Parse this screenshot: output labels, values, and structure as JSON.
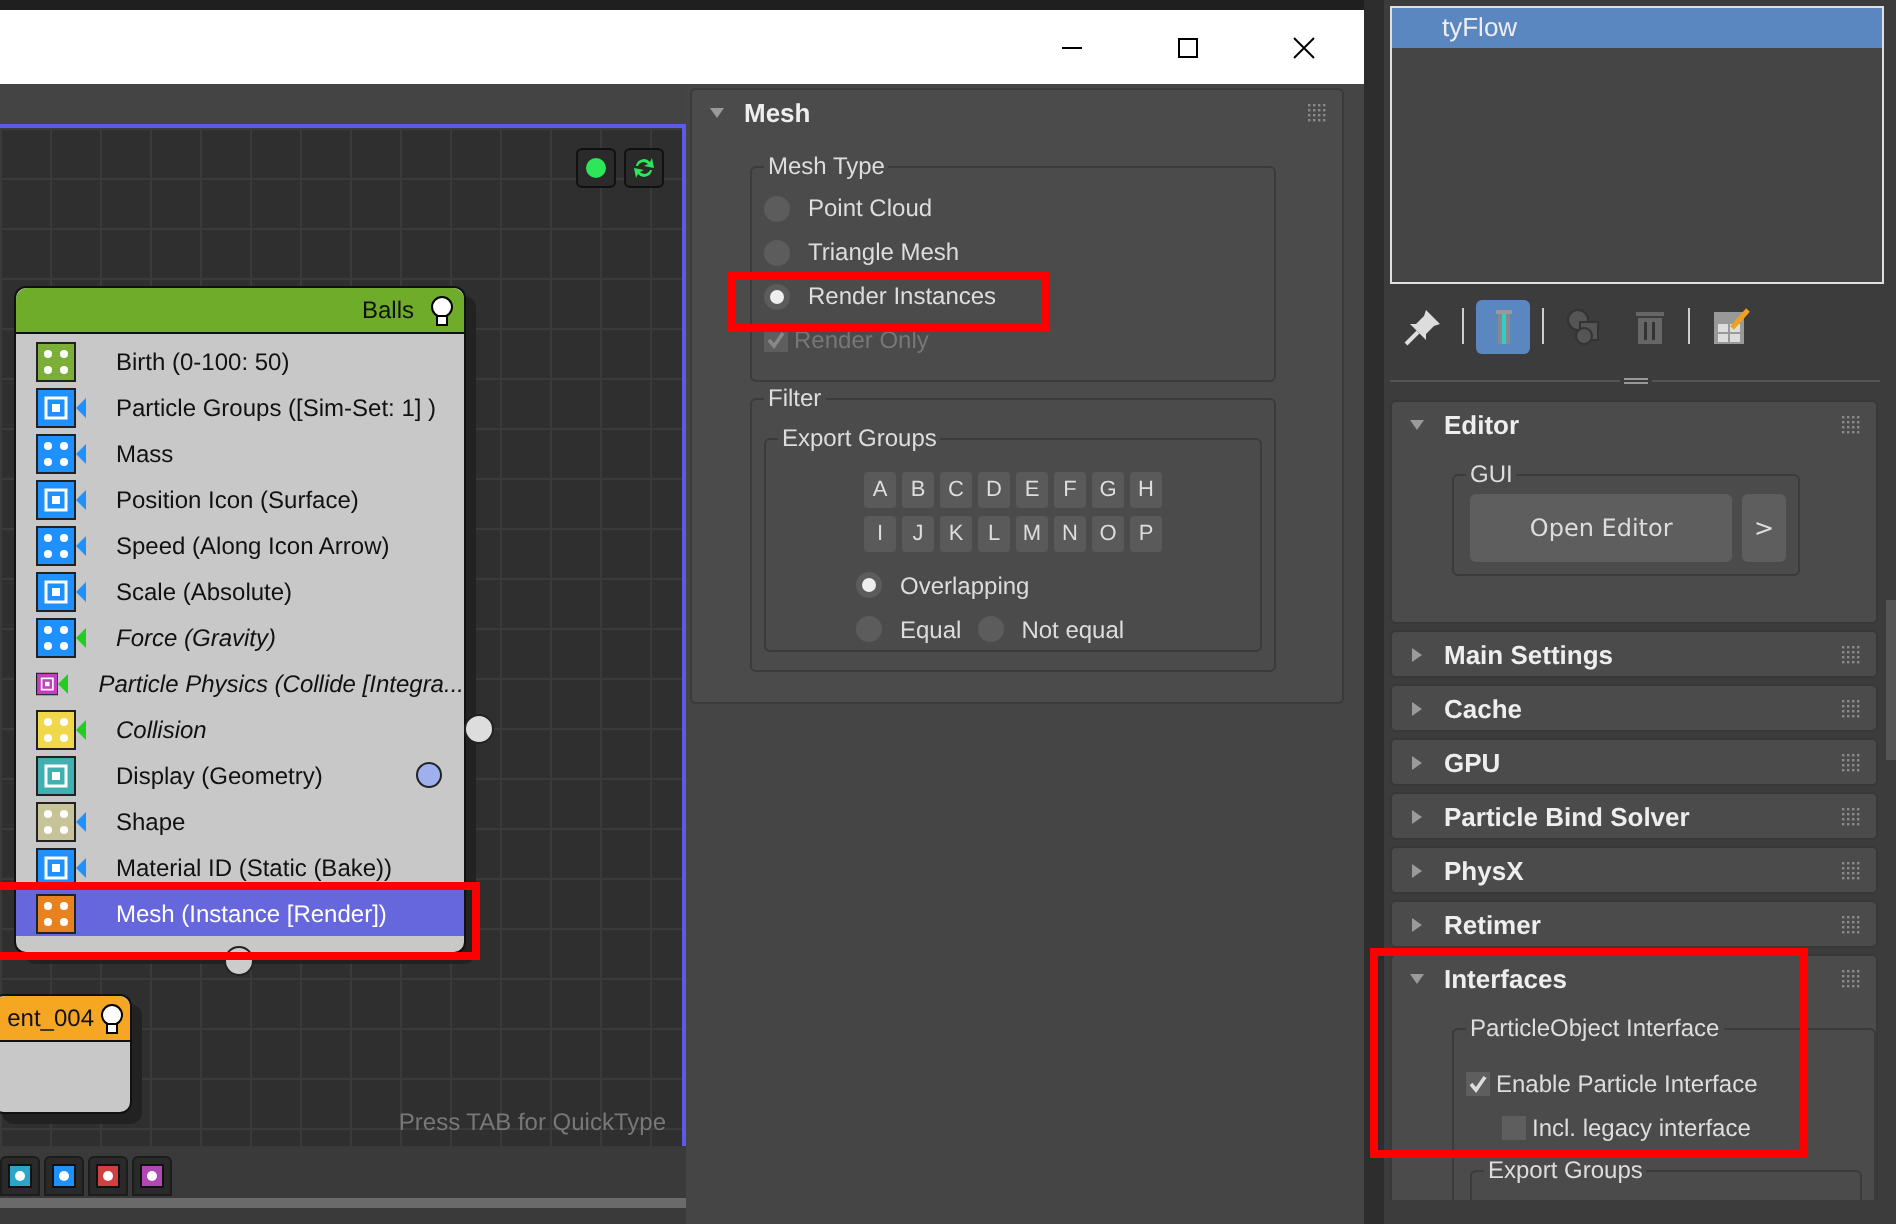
{
  "node_editor": {
    "nodes": [
      {
        "title": "Balls",
        "color": "#6fac2a",
        "items": [
          {
            "label": "Birth (0-100: 50)",
            "color": "#7cae3a",
            "kind": "plain",
            "italic": false,
            "selected": false
          },
          {
            "label": "Particle Groups ([Sim-Set: 1] )",
            "color": "#1e90ff",
            "kind": "operator",
            "italic": false,
            "selected": false
          },
          {
            "label": "Mass",
            "color": "#1e90ff",
            "kind": "operator",
            "italic": false,
            "selected": false
          },
          {
            "label": "Position Icon (Surface)",
            "color": "#1e90ff",
            "kind": "operator",
            "italic": false,
            "selected": false
          },
          {
            "label": "Speed (Along Icon Arrow)",
            "color": "#1e90ff",
            "kind": "operator",
            "italic": false,
            "selected": false
          },
          {
            "label": "Scale (Absolute)",
            "color": "#1e90ff",
            "kind": "operator",
            "italic": false,
            "selected": false
          },
          {
            "label": "Force (Gravity)",
            "color": "#1e90ff",
            "kind": "test",
            "italic": true,
            "selected": false
          },
          {
            "label": "Particle Physics (Collide [Integra...",
            "color": "#c040c0",
            "kind": "test",
            "italic": true,
            "selected": false
          },
          {
            "label": "Collision",
            "color": "#f0d84a",
            "kind": "test",
            "italic": true,
            "selected": false
          },
          {
            "label": "Display (Geometry)",
            "color": "#40b0b0",
            "kind": "plain",
            "italic": false,
            "selected": false
          },
          {
            "label": "Shape",
            "color": "#c8c49a",
            "kind": "operator",
            "italic": false,
            "selected": false
          },
          {
            "label": "Material ID (Static (Bake))",
            "color": "#1e90ff",
            "kind": "operator",
            "italic": false,
            "selected": false
          },
          {
            "label": "Mesh (Instance [Render])",
            "color": "#e8821e",
            "kind": "plain",
            "italic": false,
            "selected": true
          }
        ]
      },
      {
        "title": "ent_004",
        "color": "#f5a623"
      }
    ],
    "ports": [
      {
        "kind": "edge"
      },
      {
        "kind": "dot"
      },
      {
        "kind": "input"
      }
    ],
    "hint": "Press TAB for QuickType"
  },
  "mesh_panel": {
    "title": "Mesh",
    "expanded": true,
    "mesh_type": {
      "label": "Mesh Type",
      "options": [
        {
          "label": "Point Cloud",
          "selected": false
        },
        {
          "label": "Triangle Mesh",
          "selected": false
        },
        {
          "label": "Render Instances",
          "selected": true
        }
      ],
      "render_only": {
        "label": "Render Only",
        "checked": true,
        "disabled": true
      }
    },
    "filter": {
      "label": "Filter",
      "export_groups": {
        "label": "Export Groups",
        "letters": [
          "A",
          "B",
          "C",
          "D",
          "E",
          "F",
          "G",
          "H",
          "I",
          "J",
          "K",
          "L",
          "M",
          "N",
          "O",
          "P"
        ],
        "modes": [
          {
            "label": "Overlapping",
            "selected": true
          },
          {
            "label": "Equal",
            "selected": false
          },
          {
            "label": "Not equal",
            "selected": false
          }
        ]
      }
    }
  },
  "modifier_list": {
    "items": [
      {
        "label": "tyFlow",
        "selected": true
      }
    ]
  },
  "toolbar": [
    {
      "kind": "pin",
      "active": false
    },
    {
      "kind": "modifier",
      "active": true
    },
    {
      "kind": "unique",
      "active": false
    },
    {
      "kind": "delete",
      "active": false
    },
    {
      "kind": "configure",
      "active": false
    }
  ],
  "rollouts": [
    {
      "kind": "editor",
      "title": "Editor",
      "expanded": true,
      "group": "GUI",
      "button": "Open Editor",
      "more": ">"
    },
    {
      "kind": "plain",
      "title": "Main Settings",
      "expanded": false
    },
    {
      "kind": "plain",
      "title": "Cache",
      "expanded": false
    },
    {
      "kind": "plain",
      "title": "GPU",
      "expanded": false
    },
    {
      "kind": "plain",
      "title": "Particle Bind Solver",
      "expanded": false
    },
    {
      "kind": "plain",
      "title": "PhysX",
      "expanded": false
    },
    {
      "kind": "plain",
      "title": "Retimer",
      "expanded": false
    },
    {
      "kind": "interfaces",
      "title": "Interfaces",
      "expanded": true,
      "group": "ParticleObject Interface",
      "checkboxes": [
        {
          "label": "Enable Particle Interface",
          "checked": true,
          "indent": false
        },
        {
          "label": "Incl. legacy interface",
          "checked": false,
          "indent": true
        }
      ],
      "subgroup": "Export Groups"
    }
  ]
}
